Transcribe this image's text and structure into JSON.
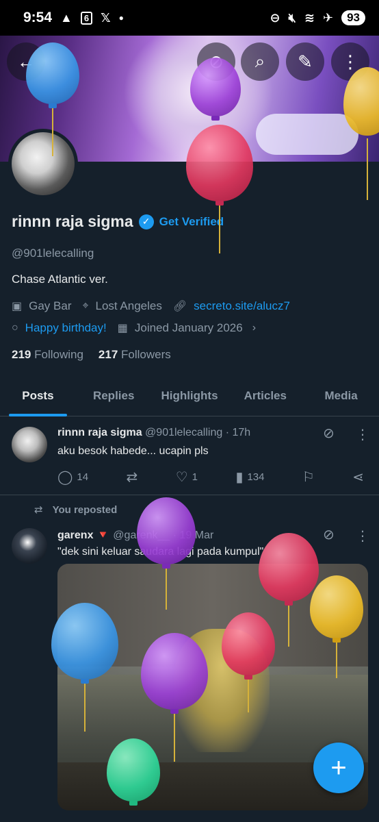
{
  "status_bar": {
    "time": "9:54",
    "left_icons": [
      "warning-icon",
      "calendar-icon",
      "x-logo-icon",
      "dot-icon"
    ],
    "calendar_day": "6",
    "right_icons": [
      "dnd-icon",
      "mute-icon",
      "wifi-icon",
      "airplane-icon"
    ],
    "battery": "93"
  },
  "header_buttons": [
    "back-icon",
    "grok-icon",
    "search-icon",
    "edit-icon",
    "more-icon"
  ],
  "profile": {
    "name": "rinnn raja sigma",
    "get_verified": "Get Verified",
    "handle": "@901lelecalling",
    "bio": "Chase Atlantic ver.",
    "category": "Gay Bar",
    "location": "Lost Angeles",
    "website": "secreto.site/alucz7",
    "birthday": "Happy birthday!",
    "joined": "Joined January 2026",
    "following_count": "219",
    "following_label": "Following",
    "followers_count": "217",
    "followers_label": "Followers"
  },
  "tabs": [
    "Posts",
    "Replies",
    "Highlights",
    "Articles",
    "Media"
  ],
  "active_tab": "Posts",
  "posts": [
    {
      "name": "rinnn raja sigma",
      "handle": "@901lelecalling",
      "time": "· 17h",
      "text": "aku besok habede... ucapin pls",
      "replies": "14",
      "reposts": "",
      "likes": "1",
      "views": "134"
    },
    {
      "repost_label": "You reposted",
      "name": "garenx",
      "flag": "🔻",
      "handle": "@garenk__",
      "time": "· 19 Mar",
      "text": "\"dek sini keluar saudara lagi pada kumpul\""
    }
  ],
  "fab_label": "+",
  "colors": {
    "background": "#15202b",
    "accent": "#1d9bf0",
    "secondary_text": "#8b98a5",
    "balloon_blue": "#3a96e6",
    "balloon_purple": "#9b3fd6",
    "balloon_red": "#e2385f",
    "balloon_yellow": "#efbe29",
    "balloon_green": "#2fd89a"
  }
}
